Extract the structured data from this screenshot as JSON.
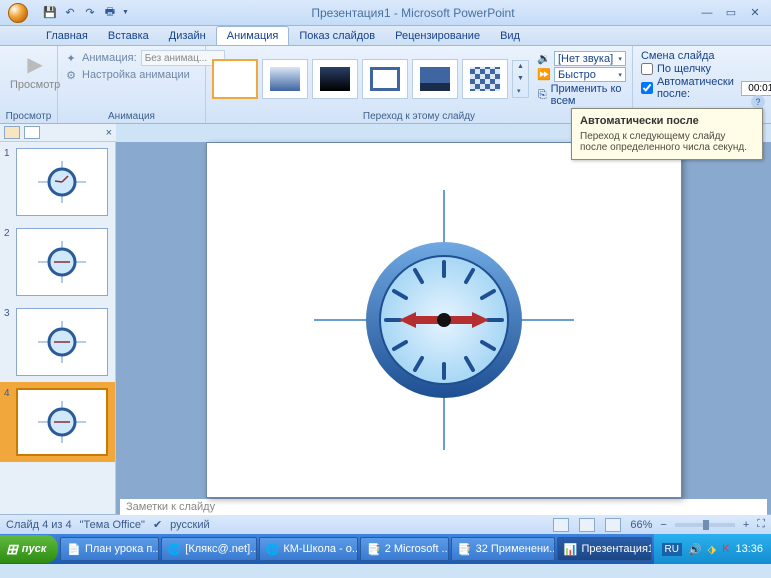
{
  "title": "Презентация1 - Microsoft PowerPoint",
  "qat": {
    "save": "save",
    "undo": "undo",
    "redo": "redo",
    "print": "print"
  },
  "tabs": [
    "Главная",
    "Вставка",
    "Дизайн",
    "Анимация",
    "Показ слайдов",
    "Рецензирование",
    "Вид"
  ],
  "active_tab": 3,
  "ribbon": {
    "preview": {
      "label": "Просмотр",
      "group": "Просмотр"
    },
    "animation": {
      "group": "Анимация",
      "row1_label": "Анимация:",
      "row1_value": "Без анимац...",
      "row2_label": "Настройка анимации"
    },
    "transition": {
      "group": "Переход к этому слайду",
      "sound_label": "[Нет звука]",
      "speed_label": "Быстро",
      "apply_all": "Применить ко всем"
    },
    "advance": {
      "group": "Смена слайда",
      "on_click": "По щелчку",
      "on_click_checked": false,
      "auto_after": "Автоматически после:",
      "auto_after_checked": true,
      "time_value": "00:01"
    }
  },
  "tooltip": {
    "title": "Автоматически после",
    "text": "Переход к следующему слайду после определенного числа секунд."
  },
  "thumbs": [
    1,
    2,
    3,
    4
  ],
  "selected_thumb": 4,
  "notes_placeholder": "Заметки к слайду",
  "status": {
    "slide_info": "Слайд 4 из 4",
    "theme": "\"Тема Office\"",
    "lang": "русский",
    "zoom": "66%"
  },
  "taskbar": {
    "start": "пуск",
    "items": [
      "План урока п...",
      "[Клякс@.net]...",
      "КМ-Школа - о...",
      "2 Microsoft ...",
      "32 Применени...",
      "Презентация1"
    ],
    "active_item": 5,
    "lang": "RU",
    "time": "13:36"
  }
}
